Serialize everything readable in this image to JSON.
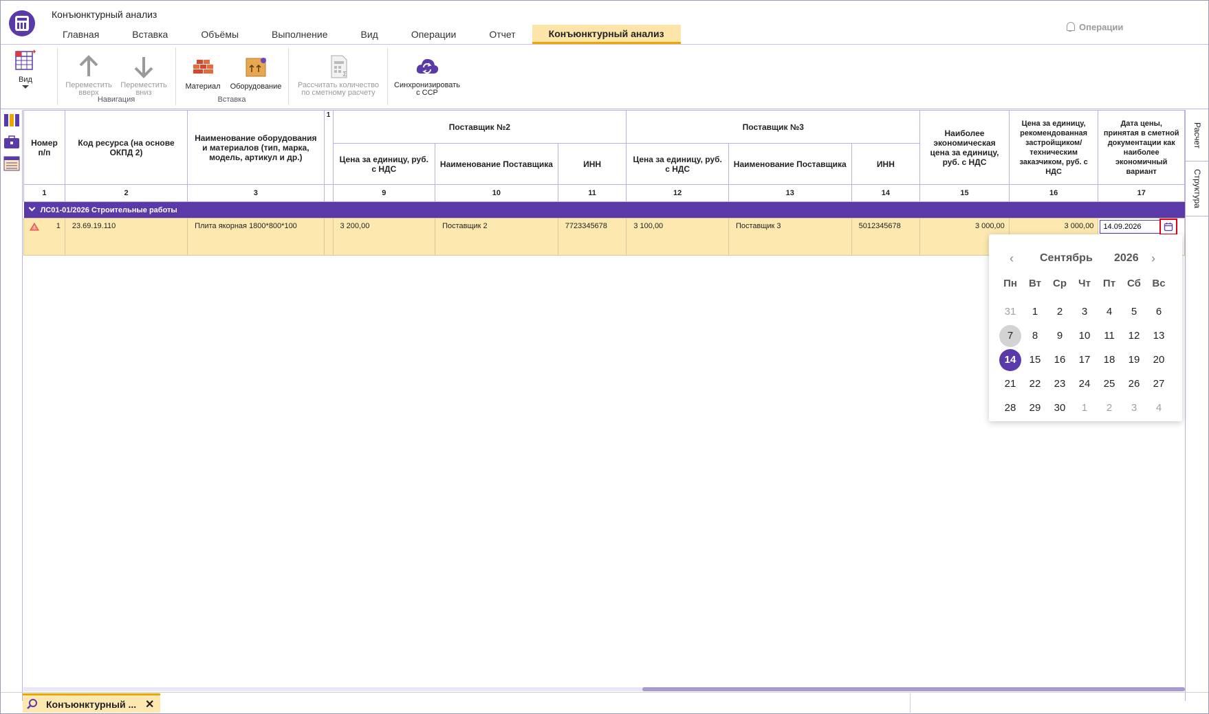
{
  "app": {
    "title": "Конъюнктурный анализ"
  },
  "tabs": [
    {
      "label": "Главная"
    },
    {
      "label": "Вставка"
    },
    {
      "label": "Объёмы"
    },
    {
      "label": "Выполнение"
    },
    {
      "label": "Вид"
    },
    {
      "label": "Операции"
    },
    {
      "label": "Отчет"
    },
    {
      "label": "Конъюнктурный анализ"
    }
  ],
  "operations_label": "Операции",
  "ribbon": {
    "view": "Вид",
    "move_up": [
      "Переместить",
      "вверх"
    ],
    "move_down": [
      "Переместить",
      "вниз"
    ],
    "nav_group": "Навигация",
    "material": "Материал",
    "equipment": "Оборудование",
    "insert_group": "Вставка",
    "calc": [
      "Рассчитать количество",
      "по сметному расчету"
    ],
    "sync": [
      "Синхронизировать",
      "с ССР"
    ]
  },
  "side_tabs": {
    "calc": "Расчет",
    "structure": "Структура"
  },
  "table": {
    "headers": {
      "num": "Номер п/п",
      "code": "Код ресурса (на основе ОКПД 2)",
      "name": "Наименование оборудования и материалов (тип, марка, модель, артикул и др.)",
      "collapsed": "1",
      "supplier2": "Поставщик №2",
      "supplier3": "Поставщик №3",
      "price": "Цена за единицу, руб. с НДС",
      "supplier_name": "Наименование Поставщика",
      "inn": "ИНН",
      "best": "Наиболее экономическая цена за единицу, руб. с НДС",
      "recommended": "Цена за единицу, рекомендованная застройщиком/ техническим заказчиком, руб. с НДС",
      "date": "Дата цены, принятая в сметной документации как наиболее экономичный вариант"
    },
    "col_numbers": [
      "1",
      "2",
      "3",
      "",
      "9",
      "10",
      "11",
      "12",
      "13",
      "14",
      "15",
      "16",
      "17"
    ],
    "group": "ЛС01-01/2026 Строительные работы",
    "row": {
      "num": "1",
      "code": "23.69.19.110",
      "name": "Плита якорная 1800*800*100",
      "price2": "3 200,00",
      "supplier2": "Поставщик 2",
      "inn2": "7723345678",
      "price3": "3 100,00",
      "supplier3": "Поставщик 3",
      "inn3": "5012345678",
      "best": "3 000,00",
      "recommended": "3 000,00",
      "date": "14.09.2026"
    }
  },
  "calendar": {
    "month": "Сентябрь",
    "year": "2026",
    "weekdays": [
      "Пн",
      "Вт",
      "Ср",
      "Чт",
      "Пт",
      "Сб",
      "Вс"
    ],
    "days": [
      {
        "d": "31",
        "muted": true
      },
      {
        "d": "1"
      },
      {
        "d": "2"
      },
      {
        "d": "3"
      },
      {
        "d": "4"
      },
      {
        "d": "5"
      },
      {
        "d": "6"
      },
      {
        "d": "7",
        "today": true
      },
      {
        "d": "8"
      },
      {
        "d": "9"
      },
      {
        "d": "10"
      },
      {
        "d": "11"
      },
      {
        "d": "12"
      },
      {
        "d": "13"
      },
      {
        "d": "14",
        "selected": true
      },
      {
        "d": "15"
      },
      {
        "d": "16"
      },
      {
        "d": "17"
      },
      {
        "d": "18"
      },
      {
        "d": "19"
      },
      {
        "d": "20"
      },
      {
        "d": "21"
      },
      {
        "d": "22"
      },
      {
        "d": "23"
      },
      {
        "d": "24"
      },
      {
        "d": "25"
      },
      {
        "d": "26"
      },
      {
        "d": "27"
      },
      {
        "d": "28"
      },
      {
        "d": "29"
      },
      {
        "d": "30"
      },
      {
        "d": "1",
        "muted": true
      },
      {
        "d": "2",
        "muted": true
      },
      {
        "d": "3",
        "muted": true
      },
      {
        "d": "4",
        "muted": true
      }
    ]
  },
  "doc_tab": {
    "label": "Конъюнктурный ..."
  },
  "colors": {
    "accent": "#5a3aa8",
    "highlight": "#fde9b0",
    "tab_active": "#f0a400"
  }
}
